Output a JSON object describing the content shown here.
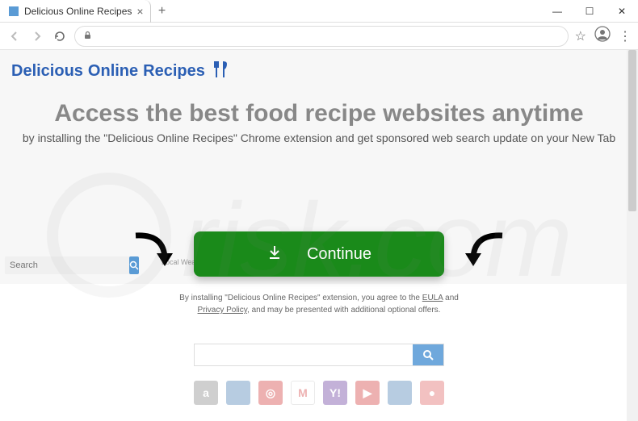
{
  "window": {
    "tab_title": "Delicious Online Recipes"
  },
  "logo": {
    "w1": "Delicious",
    "w2": "Online",
    "w3": "Recipes"
  },
  "hero": {
    "headline": "Access the best food recipe websites anytime",
    "subline": "by installing the \"Delicious Online Recipes\" Chrome extension and get sponsored web search update on your New Tab"
  },
  "mini_search": {
    "placeholder": "Search",
    "extra": "Local Weather"
  },
  "cta": {
    "label": "Continue"
  },
  "disclaimer": {
    "prefix": "By installing \"Delicious Online Recipes\" extension, you agree to the ",
    "eula": "EULA",
    "and": " and ",
    "pp": "Privacy Policy",
    "suffix": ", and may be presented with additional optional offers."
  },
  "tiles": [
    {
      "bg": "#8a8a8a",
      "txt": "a"
    },
    {
      "bg": "#4a7fb5",
      "txt": ""
    },
    {
      "bg": "#d43f3f",
      "txt": "◎"
    },
    {
      "bg": "#ffffff",
      "txt": "M"
    },
    {
      "bg": "#6b3fa0",
      "txt": "Y!"
    },
    {
      "bg": "#d43f3f",
      "txt": "▶"
    },
    {
      "bg": "#4a7fb5",
      "txt": ""
    },
    {
      "bg": "#e06666",
      "txt": "●"
    }
  ]
}
